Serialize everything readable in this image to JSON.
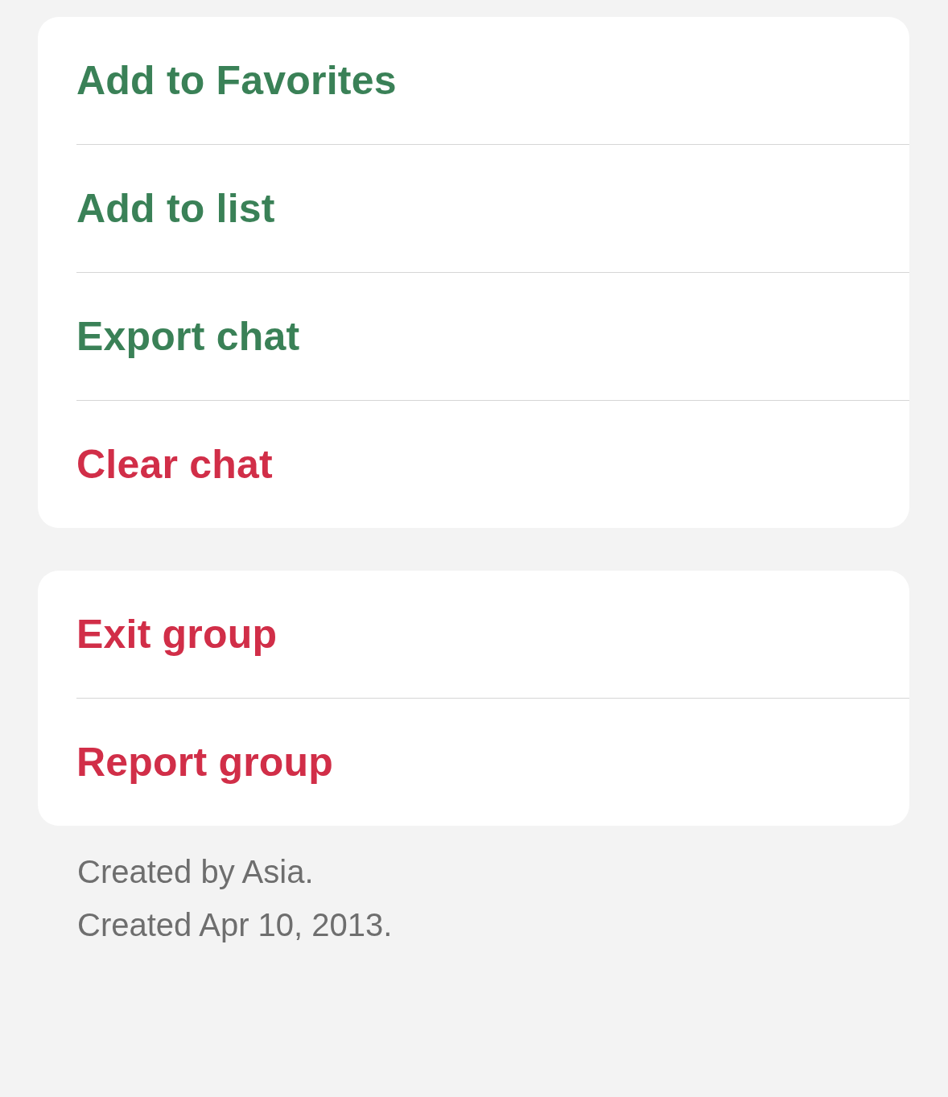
{
  "sections": [
    {
      "items": [
        {
          "label": "Add to Favorites",
          "kind": "normal"
        },
        {
          "label": "Add to list",
          "kind": "normal"
        },
        {
          "label": "Export chat",
          "kind": "normal"
        },
        {
          "label": "Clear chat",
          "kind": "destructive"
        }
      ]
    },
    {
      "items": [
        {
          "label": "Exit group",
          "kind": "destructive"
        },
        {
          "label": "Report group",
          "kind": "destructive"
        }
      ]
    }
  ],
  "footer": [
    "Created by Asia.",
    "Created Apr 10, 2013."
  ]
}
